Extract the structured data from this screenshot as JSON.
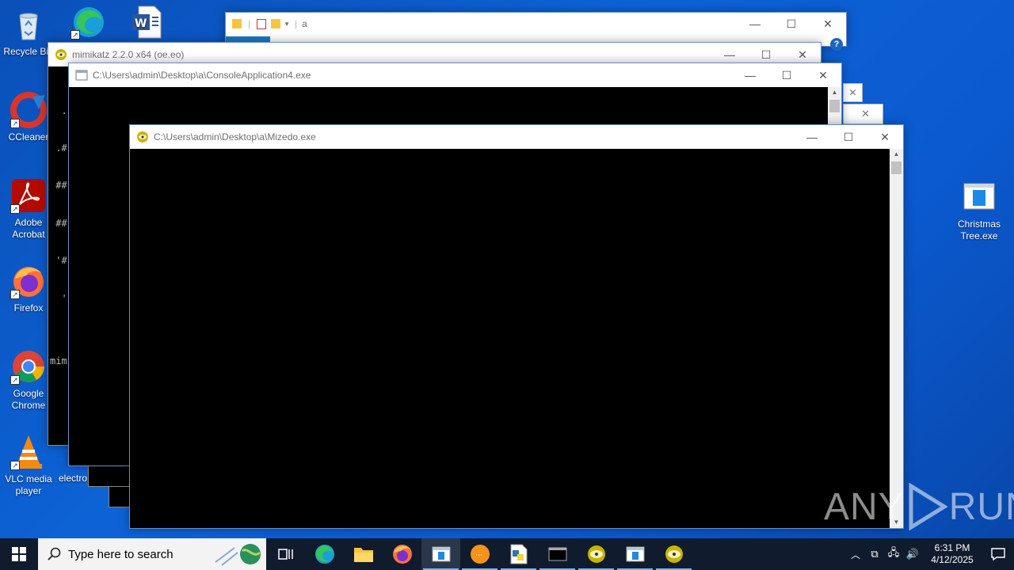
{
  "desktop": {
    "icons": [
      {
        "label": "Recycle Bin"
      },
      {
        "label": "CCleaner"
      },
      {
        "label": "Adobe Acrobat"
      },
      {
        "label": "Firefox"
      },
      {
        "label": "Google Chrome"
      },
      {
        "label": "VLC media player"
      },
      {
        "label": "Christmas Tree.exe"
      },
      {
        "label": "electro"
      }
    ]
  },
  "windows": {
    "explorer": {
      "title": "a"
    },
    "mimikatz": {
      "title": "mimikatz 2.2.0 x64 (oe.eo)",
      "lines": [
        "  .",
        " .#",
        " ##",
        " ##",
        " '#",
        "  '",
        "",
        "mimi"
      ]
    },
    "console4": {
      "title": "C:\\Users\\admin\\Desktop\\a\\ConsoleApplication4.exe"
    },
    "mizedo": {
      "title": "C:\\Users\\admin\\Desktop\\a\\Mizedo.exe"
    }
  },
  "controls": {
    "minimize": "—",
    "maximize": "☐",
    "close": "✕"
  },
  "taskbar": {
    "search_placeholder": "Type here to search",
    "time": "6:31 PM",
    "date": "4/12/2025"
  },
  "watermark": {
    "text_left": "ANY",
    "text_right": "RUN"
  }
}
